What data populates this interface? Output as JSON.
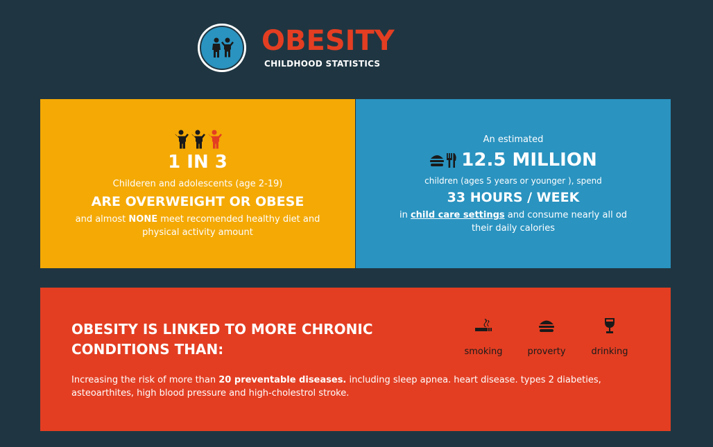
{
  "header": {
    "logo_icon": "children-icon",
    "title": "OBESITY",
    "subtitle": "CHILDHOOD STATISTICS"
  },
  "left_panel": {
    "icons": [
      "child-icon",
      "child-icon",
      "child-highlight-icon"
    ],
    "stat": "1 IN 3",
    "description": "Childeren and adolescents (age 2-19)",
    "headline": "ARE OVERWEIGHT OR OBESE",
    "note_pre": "and almost ",
    "note_bold": "NONE",
    "note_post": " meet recomended healthy diet and physical activity amount"
  },
  "right_panel": {
    "pre_text": "An estimated",
    "icon": "food-icon",
    "stat": "12.5 MILLION",
    "description": "children (ages 5 years or younger ), spend",
    "headline": "33 HOURS / WEEK",
    "note_pre": "in ",
    "note_bold": "child care settings",
    "note_post": " and consume nearly all od their daily calories"
  },
  "bottom_panel": {
    "headline": "OBESITY IS LINKED TO MORE CHRONIC CONDITIONS THAN:",
    "factors": [
      {
        "icon": "cigarette-icon",
        "label": "smoking"
      },
      {
        "icon": "burger-icon",
        "label": "proverty"
      },
      {
        "icon": "wine-glass-icon",
        "label": "drinking"
      }
    ],
    "text_pre": "Increasing the risk of more than ",
    "text_bold": "20 preventable diseases.",
    "text_post": " including sleep apnea. heart disease. types 2 diabeties, asteoarthites, high blood pressure and high-cholestrol stroke."
  },
  "colors": {
    "background": "#1f3642",
    "accent_red": "#e33e22",
    "panel_yellow": "#f4a905",
    "panel_blue": "#2a93c0"
  }
}
